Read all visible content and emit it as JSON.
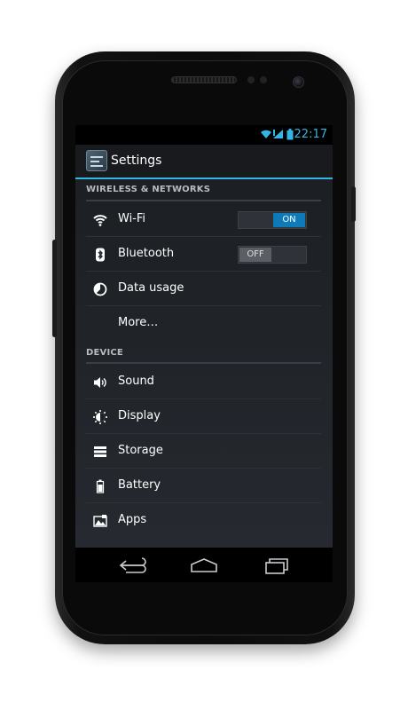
{
  "status_bar": {
    "time": "22:17",
    "icons": [
      "wifi-icon",
      "signal-icon",
      "battery-icon"
    ]
  },
  "action_bar": {
    "title": "Settings",
    "icon": "settings-app-icon"
  },
  "sections": [
    {
      "header": "WIRELESS & NETWORKS",
      "items": [
        {
          "label": "Wi-Fi",
          "icon": "wifi-icon",
          "toggle": "ON"
        },
        {
          "label": "Bluetooth",
          "icon": "bluetooth-icon",
          "toggle": "OFF"
        },
        {
          "label": "Data usage",
          "icon": "data-usage-icon"
        },
        {
          "label": "More…",
          "icon": ""
        }
      ]
    },
    {
      "header": "DEVICE",
      "items": [
        {
          "label": "Sound",
          "icon": "sound-icon"
        },
        {
          "label": "Display",
          "icon": "display-icon"
        },
        {
          "label": "Storage",
          "icon": "storage-icon"
        },
        {
          "label": "Battery",
          "icon": "battery-icon"
        },
        {
          "label": "Apps",
          "icon": "apps-icon"
        }
      ]
    }
  ],
  "nav_bar": {
    "buttons": [
      "back-icon",
      "home-icon",
      "recent-apps-icon"
    ]
  },
  "colors": {
    "accent": "#33b5e5",
    "toggle_on": "#0f7ab8",
    "background": "#1c1f23"
  }
}
